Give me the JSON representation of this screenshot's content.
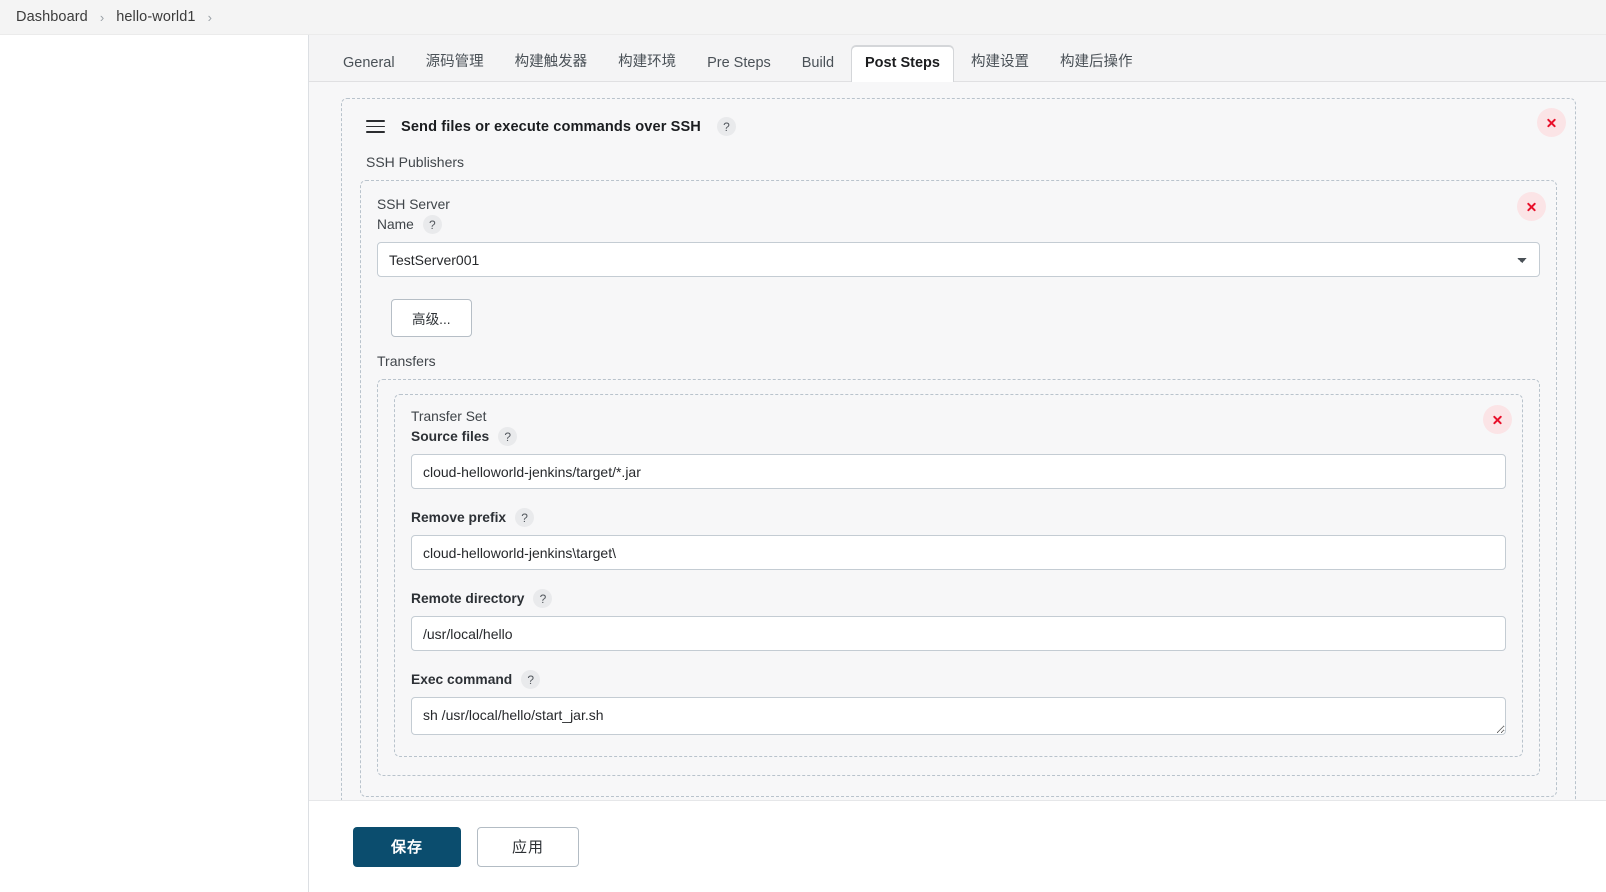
{
  "breadcrumb": {
    "items": [
      "Dashboard",
      "hello-world1"
    ],
    "separator": "›"
  },
  "tabs": [
    {
      "label": "General",
      "active": false
    },
    {
      "label": "源码管理",
      "active": false
    },
    {
      "label": "构建触发器",
      "active": false
    },
    {
      "label": "构建环境",
      "active": false
    },
    {
      "label": "Pre Steps",
      "active": false
    },
    {
      "label": "Build",
      "active": false
    },
    {
      "label": "Post Steps",
      "active": true
    },
    {
      "label": "构建设置",
      "active": false
    },
    {
      "label": "构建后操作",
      "active": false
    }
  ],
  "builder": {
    "title": "Send files or execute commands over SSH",
    "help": "?",
    "publishers_label": "SSH Publishers"
  },
  "ssh_server": {
    "group_label": "SSH Server",
    "name_label": "Name",
    "help": "?",
    "selected": "TestServer001",
    "options": [
      "TestServer001"
    ],
    "advanced_button": "高级..."
  },
  "transfers": {
    "label": "Transfers",
    "transfer_set_label": "Transfer Set",
    "fields": [
      {
        "label": "Source files",
        "help": "?",
        "value": "cloud-helloworld-jenkins/target/*.jar",
        "bold": true,
        "type": "input"
      },
      {
        "label": "Remove prefix",
        "help": "?",
        "value": "cloud-helloworld-jenkins\\target\\",
        "bold": true,
        "type": "input"
      },
      {
        "label": "Remote directory",
        "help": "?",
        "value": "/usr/local/hello",
        "bold": true,
        "type": "input"
      },
      {
        "label": "Exec command",
        "help": "?",
        "value": "sh /usr/local/hello/start_jar.sh",
        "bold": true,
        "type": "textarea"
      }
    ]
  },
  "footer": {
    "save_label": "保存",
    "apply_label": "应用"
  },
  "colors": {
    "primary": "#0b4d6e",
    "delete_bg": "#fbe4e6",
    "delete_fg": "#e8102a",
    "dashed_border": "#b9c3cc",
    "page_bg": "#f7f7f8"
  }
}
